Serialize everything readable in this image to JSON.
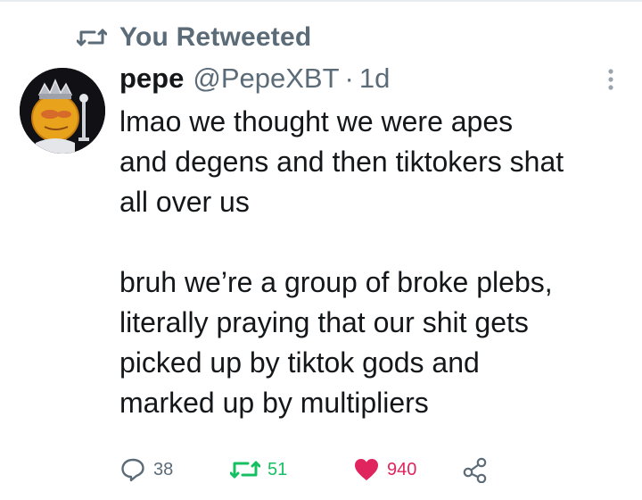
{
  "retweet_banner": {
    "label": "You Retweeted",
    "icon": "retweet-icon"
  },
  "tweet": {
    "author": {
      "display_name": "pepe",
      "handle": "@PepeXBT",
      "avatar_icon": "pepe-king-avatar"
    },
    "separator": "·",
    "time": "1d",
    "more_icon": "more-vertical-icon",
    "text": "lmao we thought we were apes\nand degens and then tiktokers shat\nall over us\n\nbruh we’re a group of broke plebs,\nliterally praying that our shit gets\npicked up by tiktok gods and\nmarked up by multipliers",
    "actions": {
      "reply": {
        "icon": "reply-icon",
        "count": "38"
      },
      "retweet": {
        "icon": "retweet-icon",
        "count": "51",
        "active": true,
        "color": "#17bf63"
      },
      "like": {
        "icon": "heart-icon",
        "count": "940",
        "active": true,
        "color": "#e0245e"
      },
      "share": {
        "icon": "share-icon"
      }
    }
  },
  "colors": {
    "text_primary": "#14171a",
    "text_secondary": "#5b6b78",
    "retweet_green": "#17bf63",
    "like_pink": "#e0245e"
  }
}
